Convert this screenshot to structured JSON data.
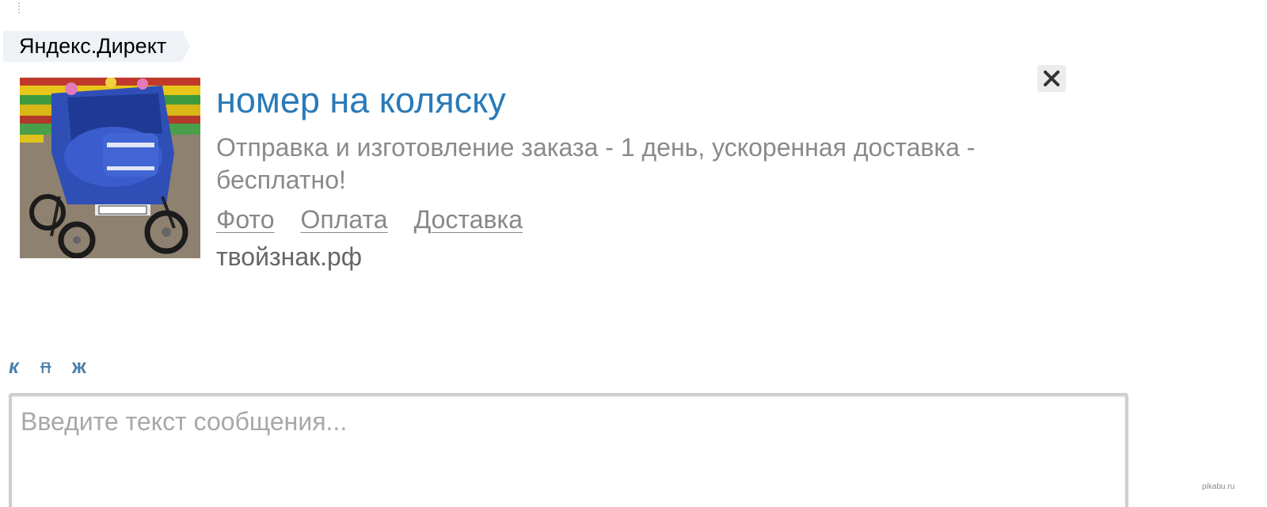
{
  "ad": {
    "provider_label": "Яндекс.Директ",
    "title": "номер на коляску",
    "text": "Отправка и изготовление заказа - 1 день, ускоренная доставка - бесплатно!",
    "sitelinks": [
      "Фото",
      "Оплата",
      "Доставка"
    ],
    "domain": "твойзнак.рф",
    "image_icon": "baby-stroller-photo",
    "close_icon": "close-icon"
  },
  "formatting": {
    "italic_label": "к",
    "strike_label": "п",
    "bold_label": "ж"
  },
  "message": {
    "placeholder": "Введите текст сообщения...",
    "value": ""
  },
  "watermark": "pikabu.ru",
  "colors": {
    "title": "#2a7ab8",
    "text": "#8a8a8a",
    "format_buttons": "#4a7ea8",
    "badge_bg": "#eef1f6"
  }
}
